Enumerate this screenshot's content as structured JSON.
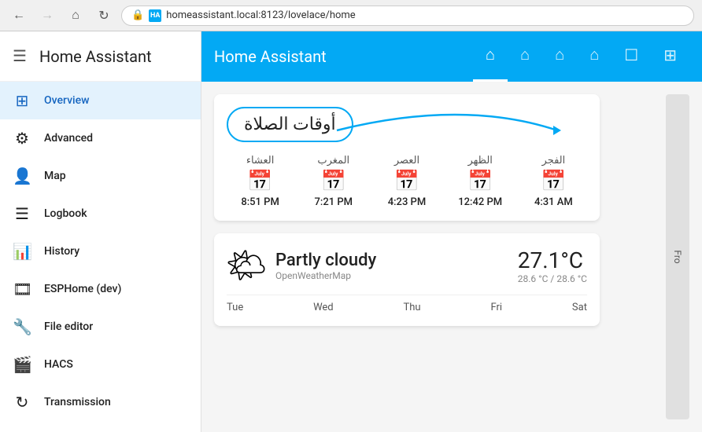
{
  "browser": {
    "back_disabled": false,
    "forward_disabled": true,
    "url": "homeassistant.local:8123/lovelace/home",
    "reload_title": "Reload"
  },
  "sidebar": {
    "menu_icon": "☰",
    "title": "Home Assistant",
    "items": [
      {
        "id": "overview",
        "label": "Overview",
        "icon": "⊞",
        "active": true
      },
      {
        "id": "advanced",
        "label": "Advanced",
        "icon": "⚙",
        "active": false
      },
      {
        "id": "map",
        "label": "Map",
        "icon": "👤",
        "active": false
      },
      {
        "id": "logbook",
        "label": "Logbook",
        "icon": "☰",
        "active": false
      },
      {
        "id": "history",
        "label": "History",
        "icon": "📊",
        "active": false
      },
      {
        "id": "esphome",
        "label": "ESPHome (dev)",
        "icon": "🎞",
        "active": false
      },
      {
        "id": "file-editor",
        "label": "File editor",
        "icon": "🔧",
        "active": false
      },
      {
        "id": "hacs",
        "label": "HACS",
        "icon": "🎬",
        "active": false
      },
      {
        "id": "transmission",
        "label": "Transmission",
        "icon": "🔄",
        "active": false
      }
    ]
  },
  "topbar": {
    "title": "Home Assistant",
    "tabs": [
      {
        "id": "home",
        "icon": "🏠",
        "active": true
      },
      {
        "id": "building",
        "icon": "🏗",
        "active": false
      },
      {
        "id": "house",
        "icon": "🏠",
        "active": false
      },
      {
        "id": "chair",
        "icon": "🛋",
        "active": false
      },
      {
        "id": "monitor",
        "icon": "🖥",
        "active": false
      },
      {
        "id": "network",
        "icon": "⚙",
        "active": false
      }
    ]
  },
  "prayer_card": {
    "title": "أوقات الصلاة",
    "prayers": [
      {
        "name": "الفجر",
        "time": "4:31 AM"
      },
      {
        "name": "الظهر",
        "time": "12:42 PM"
      },
      {
        "name": "العصر",
        "time": "4:23 PM"
      },
      {
        "name": "المغرب",
        "time": "7:21 PM"
      },
      {
        "name": "العشاء",
        "time": "8:51 PM"
      }
    ]
  },
  "weather_card": {
    "condition": "Partly cloudy",
    "source": "OpenWeatherMap",
    "temperature": "27.1°C",
    "temp_high": "28.6 °C",
    "temp_low": "28.6 °C",
    "days": [
      "Tue",
      "Wed",
      "Thu",
      "Fri",
      "Sat"
    ]
  },
  "right_panel": {
    "label": "Fro"
  },
  "colors": {
    "primary": "#03a9f4",
    "active_nav_bg": "#e3f2fd",
    "active_nav_text": "#1565C0"
  }
}
